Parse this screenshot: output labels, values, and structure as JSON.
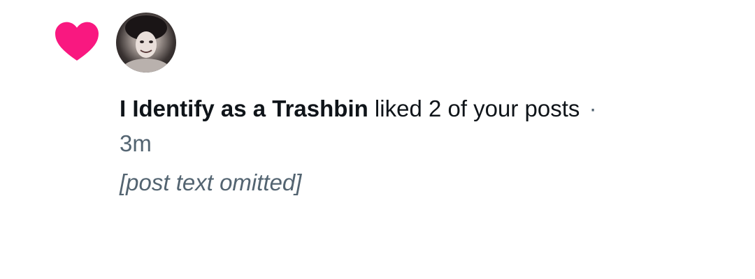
{
  "colors": {
    "like_accent": "#f91880",
    "primary_text": "#0f1419",
    "secondary_text": "#536471",
    "background": "#ffffff"
  },
  "notification": {
    "icon": "heart-icon",
    "avatar": "avatar",
    "username": "I Identify as a Trashbin",
    "action": " liked 2 of your posts",
    "separator": "·",
    "timestamp": "3m",
    "post_preview": "[post text omitted]"
  }
}
